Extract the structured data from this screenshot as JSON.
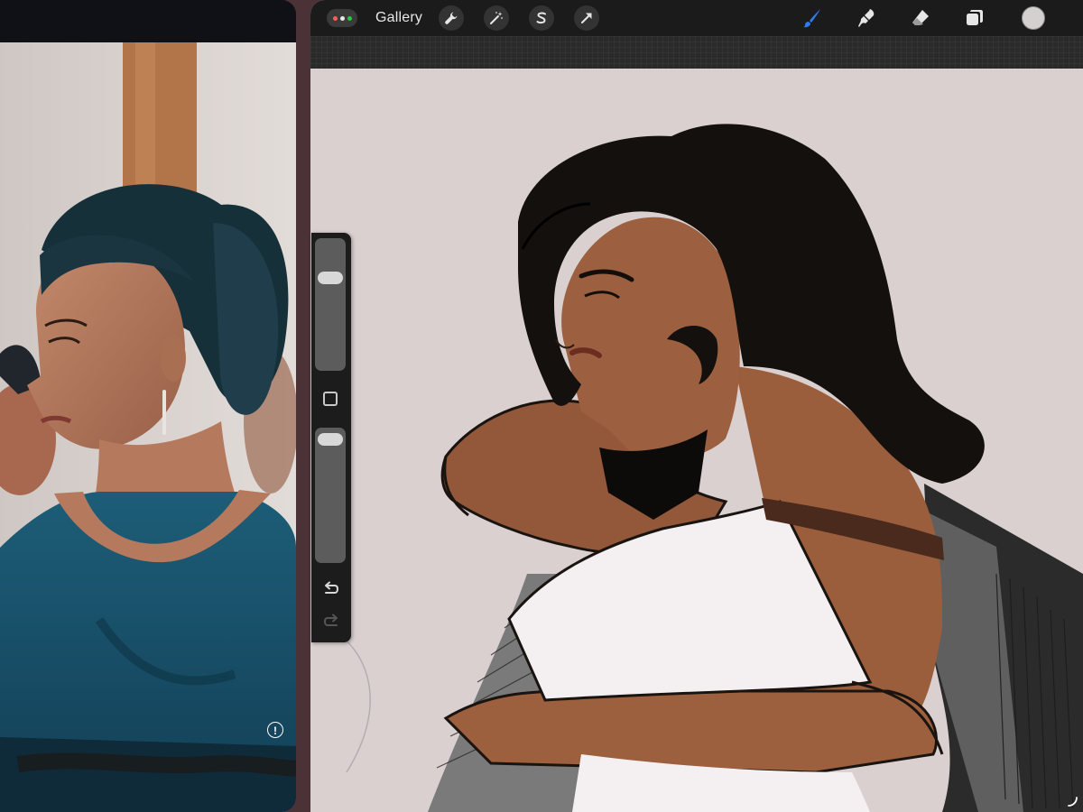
{
  "toolbar": {
    "gallery_label": "Gallery",
    "left_tools": [
      "wrench-icon",
      "magic-wand-icon",
      "selection-s-icon",
      "arrow-transform-icon"
    ],
    "right_tools": [
      "brush-icon",
      "smudge-icon",
      "eraser-icon",
      "layers-icon"
    ],
    "active_tool": "brush-icon",
    "active_color": "#2a7bff",
    "current_color": "#d4d0cf"
  },
  "multitask_dots": [
    "#ff5f57",
    "#e8e8e8",
    "#28c840"
  ],
  "side_bar": {
    "brush_size": 0.73,
    "opacity": 0.98,
    "controls": [
      "modify-square-icon",
      "undo-icon",
      "redo-icon"
    ]
  },
  "reference_pane": {
    "info_glyph": "!"
  },
  "canvas": {
    "background": "#d9d0cf",
    "skin": "#9a5e3c",
    "hair": "#14100d",
    "dress": "#f4f0f1"
  }
}
